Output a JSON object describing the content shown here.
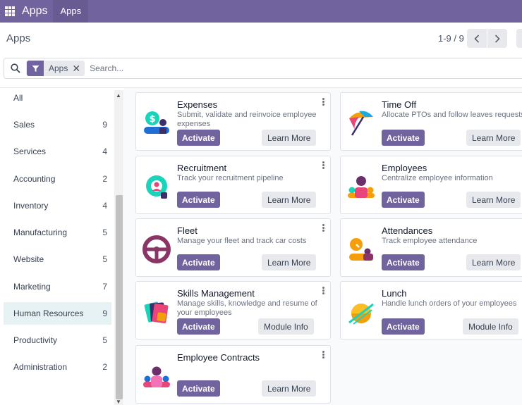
{
  "navbar": {
    "brand": "Apps",
    "menu_item": "Apps"
  },
  "control_panel": {
    "title": "Apps",
    "pager_value": "1-9 / 9",
    "search": {
      "facet_label": "Apps",
      "placeholder": "Search..."
    }
  },
  "sidebar": {
    "categories": [
      {
        "label": "All",
        "count": ""
      },
      {
        "label": "Sales",
        "count": "9"
      },
      {
        "label": "Services",
        "count": "4"
      },
      {
        "label": "Accounting",
        "count": "2"
      },
      {
        "label": "Inventory",
        "count": "4"
      },
      {
        "label": "Manufacturing",
        "count": "5"
      },
      {
        "label": "Website",
        "count": "5"
      },
      {
        "label": "Marketing",
        "count": "7"
      },
      {
        "label": "Human Resources",
        "count": "9",
        "active": true
      },
      {
        "label": "Productivity",
        "count": "5"
      },
      {
        "label": "Administration",
        "count": "2"
      }
    ]
  },
  "apps": [
    {
      "name": "Expenses",
      "description": "Submit, validate and reinvoice employee expenses",
      "icon": "expenses-icon",
      "primary": "Activate",
      "secondary": "Learn More"
    },
    {
      "name": "Time Off",
      "description": "Allocate PTOs and follow leaves requests",
      "icon": "time-off-icon",
      "primary": "Activate",
      "secondary": "Learn More"
    },
    {
      "name": "Recruitment",
      "description": "Track your recruitment pipeline",
      "icon": "recruitment-icon",
      "primary": "Activate",
      "secondary": "Learn More"
    },
    {
      "name": "Employees",
      "description": "Centralize employee information",
      "icon": "employees-icon",
      "primary": "Activate",
      "secondary": "Learn More"
    },
    {
      "name": "Fleet",
      "description": "Manage your fleet and track car costs",
      "icon": "fleet-icon",
      "primary": "Activate",
      "secondary": "Learn More"
    },
    {
      "name": "Attendances",
      "description": "Track employee attendance",
      "icon": "attendances-icon",
      "primary": "Activate",
      "secondary": "Learn More"
    },
    {
      "name": "Skills Management",
      "description": "Manage skills, knowledge and resume of your employees",
      "icon": "skills-icon",
      "primary": "Activate",
      "secondary": "Module Info"
    },
    {
      "name": "Lunch",
      "description": "Handle lunch orders of your employees",
      "icon": "lunch-icon",
      "primary": "Activate",
      "secondary": "Module Info"
    },
    {
      "name": "Employee Contracts",
      "description": "",
      "icon": "contracts-icon",
      "primary": "Activate",
      "secondary": "Learn More"
    }
  ],
  "colors": {
    "brand": "#71639e",
    "active_category_bg": "#e6f2f3",
    "secondary_button_bg": "#e7e9ed"
  }
}
